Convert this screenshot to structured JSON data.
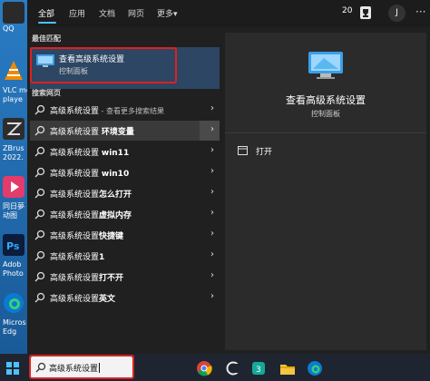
{
  "desktop": {
    "icons": [
      {
        "label": "QQ",
        "color": "#2a2a2a"
      },
      {
        "label": "VLC me",
        "label2": "playe",
        "color": "#f08a00"
      },
      {
        "label": "ZBrus",
        "label2": "2022.",
        "color": "#2d2d2d"
      },
      {
        "label": "同日夢",
        "label2": "动图",
        "color": "#e33b6b"
      },
      {
        "label": "Adob",
        "label2": "Photo",
        "color": "#0b1d3a"
      },
      {
        "label": "Micros",
        "label2": "Edg",
        "color": "#0b7bcf"
      }
    ]
  },
  "tabs": {
    "items": [
      "全部",
      "应用",
      "文档",
      "网页",
      "更多"
    ],
    "more_arrow": "▾"
  },
  "topbar": {
    "points": "20",
    "avatar_letter": "J",
    "more": "···"
  },
  "best_match": {
    "section": "最佳匹配",
    "title": "查看高级系统设置",
    "subtitle": "控制面板"
  },
  "web_search": {
    "section": "搜索网页",
    "items": [
      {
        "text": "高级系统设置",
        "sub": " - 查看更多搜索结果",
        "bold": ""
      },
      {
        "text": "高级系统设置 ",
        "sub": "",
        "bold": "环境变量"
      },
      {
        "text": "高级系统设置 ",
        "sub": "",
        "bold": "win11"
      },
      {
        "text": "高级系统设置 ",
        "sub": "",
        "bold": "win10"
      },
      {
        "text": "高级系统设置",
        "sub": "",
        "bold": "怎么打开"
      },
      {
        "text": "高级系统设置",
        "sub": "",
        "bold": "虚拟内存"
      },
      {
        "text": "高级系统设置",
        "sub": "",
        "bold": "快捷键"
      },
      {
        "text": "高级系统设置",
        "sub": "",
        "bold": "1"
      },
      {
        "text": "高级系统设置",
        "sub": "",
        "bold": "打不开"
      },
      {
        "text": "高级系统设置",
        "sub": "",
        "bold": "英文"
      }
    ]
  },
  "detail": {
    "title": "查看高级系统设置",
    "subtitle": "控制面板",
    "open_label": "打开"
  },
  "taskbar": {
    "search_value": "高级系统设置"
  },
  "colors": {
    "accent": "#4cc2ff",
    "highlight": "#e02020",
    "panel": "#202020"
  }
}
